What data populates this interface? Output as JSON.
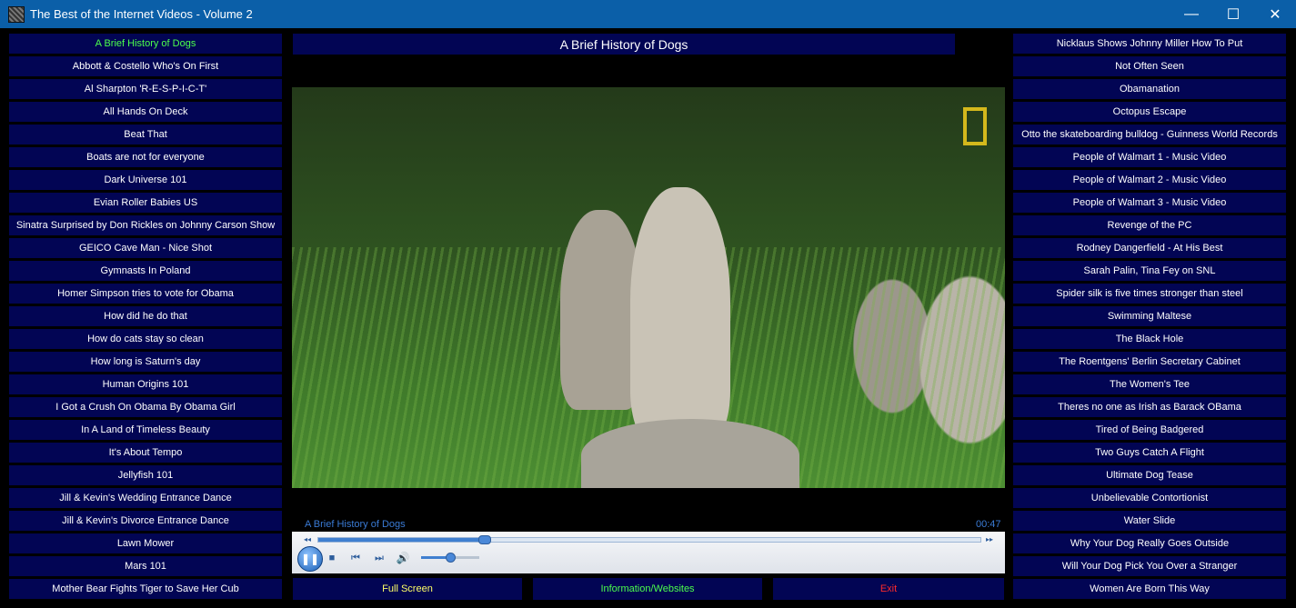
{
  "window": {
    "title": "The Best of the Internet Videos - Volume 2",
    "minimize_glyph": "—",
    "maximize_glyph": "☐",
    "close_glyph": "✕"
  },
  "left_list": [
    "A Brief History of Dogs",
    "Abbott & Costello Who's On First",
    "Al Sharpton  'R-E-S-P-I-C-T'",
    "All Hands On Deck",
    "Beat That",
    "Boats are not for everyone",
    "Dark Universe 101",
    "Evian Roller Babies US",
    "Sinatra Surprised by Don Rickles on Johnny Carson Show",
    "GEICO Cave Man - Nice Shot",
    "Gymnasts In Poland",
    "Homer Simpson tries to vote for Obama",
    "How did he do that",
    "How do cats stay so clean",
    "How long is Saturn's day",
    "Human Origins 101",
    "I Got a Crush On Obama By Obama Girl",
    "In A Land of Timeless Beauty",
    "It's About Tempo",
    "Jellyfish 101",
    "Jill & Kevin's Wedding Entrance Dance",
    "Jill & Kevin's Divorce Entrance Dance",
    "Lawn Mower",
    "Mars 101",
    "Mother Bear Fights Tiger to Save Her Cub"
  ],
  "right_list": [
    "Nicklaus Shows Johnny Miller How To Put",
    "Not Often Seen",
    "Obamanation",
    "Octopus Escape",
    "Otto the skateboarding bulldog - Guinness World Records",
    "People of Walmart 1 - Music Video",
    "People of Walmart 2 - Music Video",
    "People of Walmart 3 - Music Video",
    "Revenge of the PC",
    "Rodney Dangerfield - At His Best",
    "Sarah Palin, Tina Fey on SNL",
    "Spider silk is five times stronger than steel",
    "Swimming Maltese",
    "The Black Hole",
    "The Roentgens' Berlin Secretary Cabinet",
    "The Women's Tee",
    "Theres no one as Irish as Barack OBama",
    "Tired of Being Badgered",
    "Two Guys Catch A Flight",
    "Ultimate Dog Tease",
    "Unbelievable Contortionist",
    "Water Slide",
    "Why Your Dog Really Goes Outside",
    "Will Your Dog Pick You Over a Stranger",
    "Women Are Born This Way"
  ],
  "player": {
    "current_title": "A Brief History of Dogs",
    "status_title": "A Brief History of Dogs",
    "time": "00:47",
    "progress_fraction": 0.25,
    "volume_fraction": 0.5,
    "icons": {
      "play_pause": "pause-icon",
      "stop": "stop-icon",
      "prev": "previous-icon",
      "next": "next-icon",
      "volume": "speaker-icon"
    },
    "glyphs": {
      "pause": "❚❚",
      "stop": "■",
      "prev": "⏮",
      "next": "⏭",
      "volume": "🔊",
      "rewind": "◂◂",
      "forward": "▸▸"
    }
  },
  "buttons": {
    "full_screen": "Full Screen",
    "info": "Information/Websites",
    "exit": "Exit"
  },
  "colors": {
    "list_bg": "#020554",
    "active_item": "#4cff4c",
    "info_text": "#4cff4c",
    "exit_text": "#ff2a2a",
    "full_screen_text": "#ffff66",
    "titlebar": "#0b5fa8"
  }
}
